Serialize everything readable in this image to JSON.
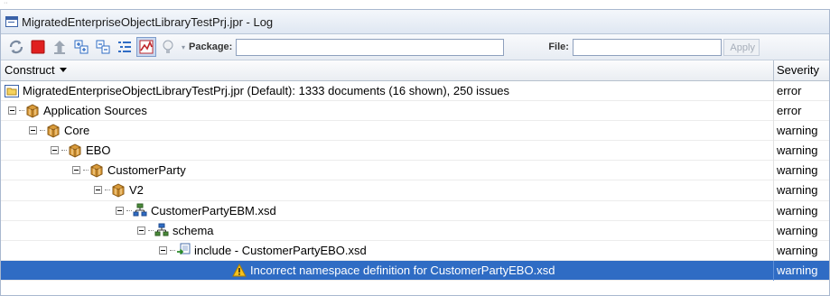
{
  "window": {
    "title": "MigratedEnterpriseObjectLibraryTestPrj.jpr - Log"
  },
  "toolbar": {
    "icons": [
      "refresh-icon",
      "stop-icon",
      "upload-icon",
      "expand-all-icon",
      "collapse-all-icon",
      "outline-icon",
      "chart-icon",
      "lightbulb-icon"
    ],
    "package_label": "Package:",
    "package_value": "",
    "file_label": "File:",
    "file_value": "",
    "apply_label": "Apply"
  },
  "columns": {
    "construct": "Construct",
    "severity": "Severity"
  },
  "rows": [
    {
      "label": "MigratedEnterpriseObjectLibraryTestPrj.jpr (Default): 1333 documents (16 shown), 250 issues",
      "severity": "error",
      "icon": "project-icon",
      "level": 0
    },
    {
      "label": "Application Sources",
      "severity": "error",
      "icon": "package-icon",
      "level": 1
    },
    {
      "label": "Core",
      "severity": "warning",
      "icon": "package-icon",
      "level": 2
    },
    {
      "label": "EBO",
      "severity": "warning",
      "icon": "package-icon",
      "level": 3
    },
    {
      "label": "CustomerParty",
      "severity": "warning",
      "icon": "package-icon",
      "level": 4
    },
    {
      "label": "V2",
      "severity": "warning",
      "icon": "package-icon",
      "level": 5
    },
    {
      "label": "CustomerPartyEBM.xsd",
      "severity": "warning",
      "icon": "schema-file-icon",
      "level": 6
    },
    {
      "label": "schema",
      "severity": "warning",
      "icon": "schema-node-icon",
      "level": 7
    },
    {
      "label": "include - CustomerPartyEBO.xsd",
      "severity": "warning",
      "icon": "include-icon",
      "level": 8
    },
    {
      "label": "Incorrect namespace definition for CustomerPartyEBO.xsd",
      "severity": "warning",
      "icon": "warning-icon",
      "level": 9,
      "selected": true
    }
  ],
  "colors": {
    "selection": "#2f6cc4",
    "title_gradient_top": "#f4f7fb",
    "title_gradient_bottom": "#dfe7f2"
  }
}
